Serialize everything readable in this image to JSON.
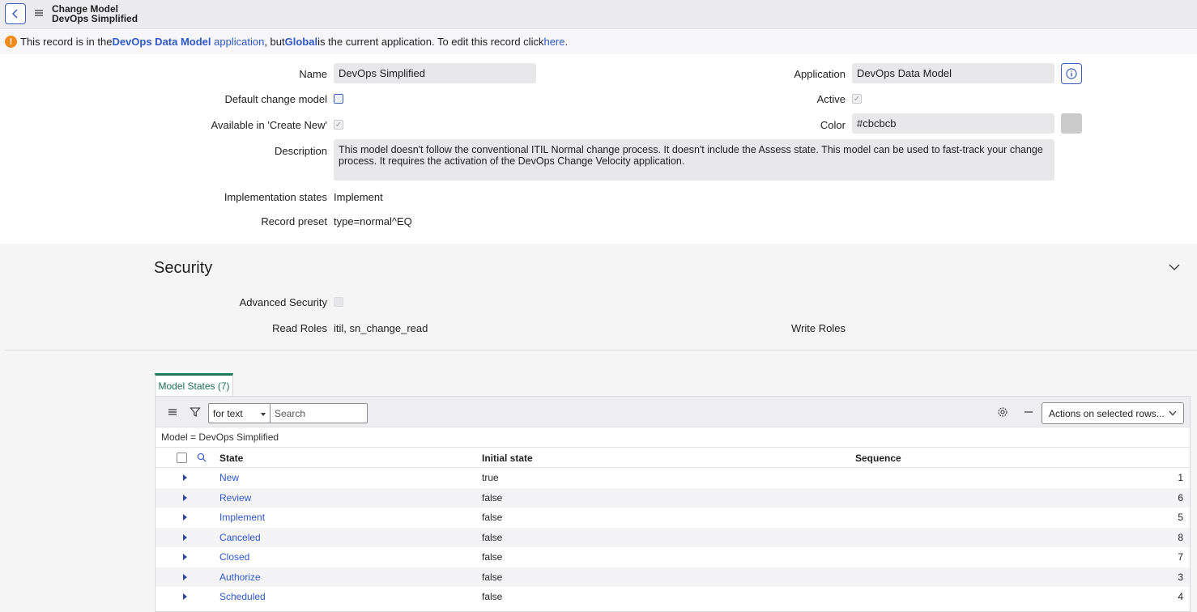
{
  "header": {
    "title_line1": "Change Model",
    "title_line2": "DevOps Simplified"
  },
  "notice": {
    "text1": "This record is in the ",
    "scope_name": "DevOps Data Model",
    "scope_link": "application",
    "text2": ", but ",
    "current_app": "Global",
    "text3": " is the current application. To edit this record click ",
    "here_link": "here",
    "text4": "."
  },
  "form": {
    "name_label": "Name",
    "name_value": "DevOps Simplified",
    "default_change_model_label": "Default change model",
    "available_label": "Available in 'Create New'",
    "available_check": "✓",
    "description_label": "Description",
    "description_value": "This model doesn't follow the conventional ITIL Normal change process. It doesn't include the Assess state. This model can be used to fast-track your change process. It requires the activation of the DevOps Change Velocity application.",
    "implementation_states_label": "Implementation states",
    "implementation_states_value": "Implement",
    "record_preset_label": "Record preset",
    "record_preset_value": "type=normal^EQ",
    "application_label": "Application",
    "application_value": "DevOps Data Model",
    "active_label": "Active",
    "active_check": "✓",
    "color_label": "Color",
    "color_value": "#cbcbcb"
  },
  "security": {
    "title": "Security",
    "advanced_security_label": "Advanced Security",
    "read_roles_label": "Read Roles",
    "read_roles_value": "itil, sn_change_read",
    "write_roles_label": "Write Roles"
  },
  "related_list": {
    "tab_label": "Model States (7)",
    "filter_select": "for text",
    "search_placeholder": "Search",
    "actions_label": "Actions on selected rows...",
    "breadcrumb": "Model = DevOps Simplified",
    "columns": [
      "State",
      "Initial state",
      "Sequence"
    ],
    "rows": [
      {
        "state": "New",
        "initial": "true",
        "sequence": "1"
      },
      {
        "state": "Review",
        "initial": "false",
        "sequence": "6"
      },
      {
        "state": "Implement",
        "initial": "false",
        "sequence": "5"
      },
      {
        "state": "Canceled",
        "initial": "false",
        "sequence": "8"
      },
      {
        "state": "Closed",
        "initial": "false",
        "sequence": "7"
      },
      {
        "state": "Authorize",
        "initial": "false",
        "sequence": "3"
      },
      {
        "state": "Scheduled",
        "initial": "false",
        "sequence": "4"
      }
    ]
  },
  "colors": {
    "accent": "#2f58c9",
    "tab_green": "#1d7a5a",
    "warning": "#f08a1c",
    "swatch": "#cbcbcb"
  }
}
